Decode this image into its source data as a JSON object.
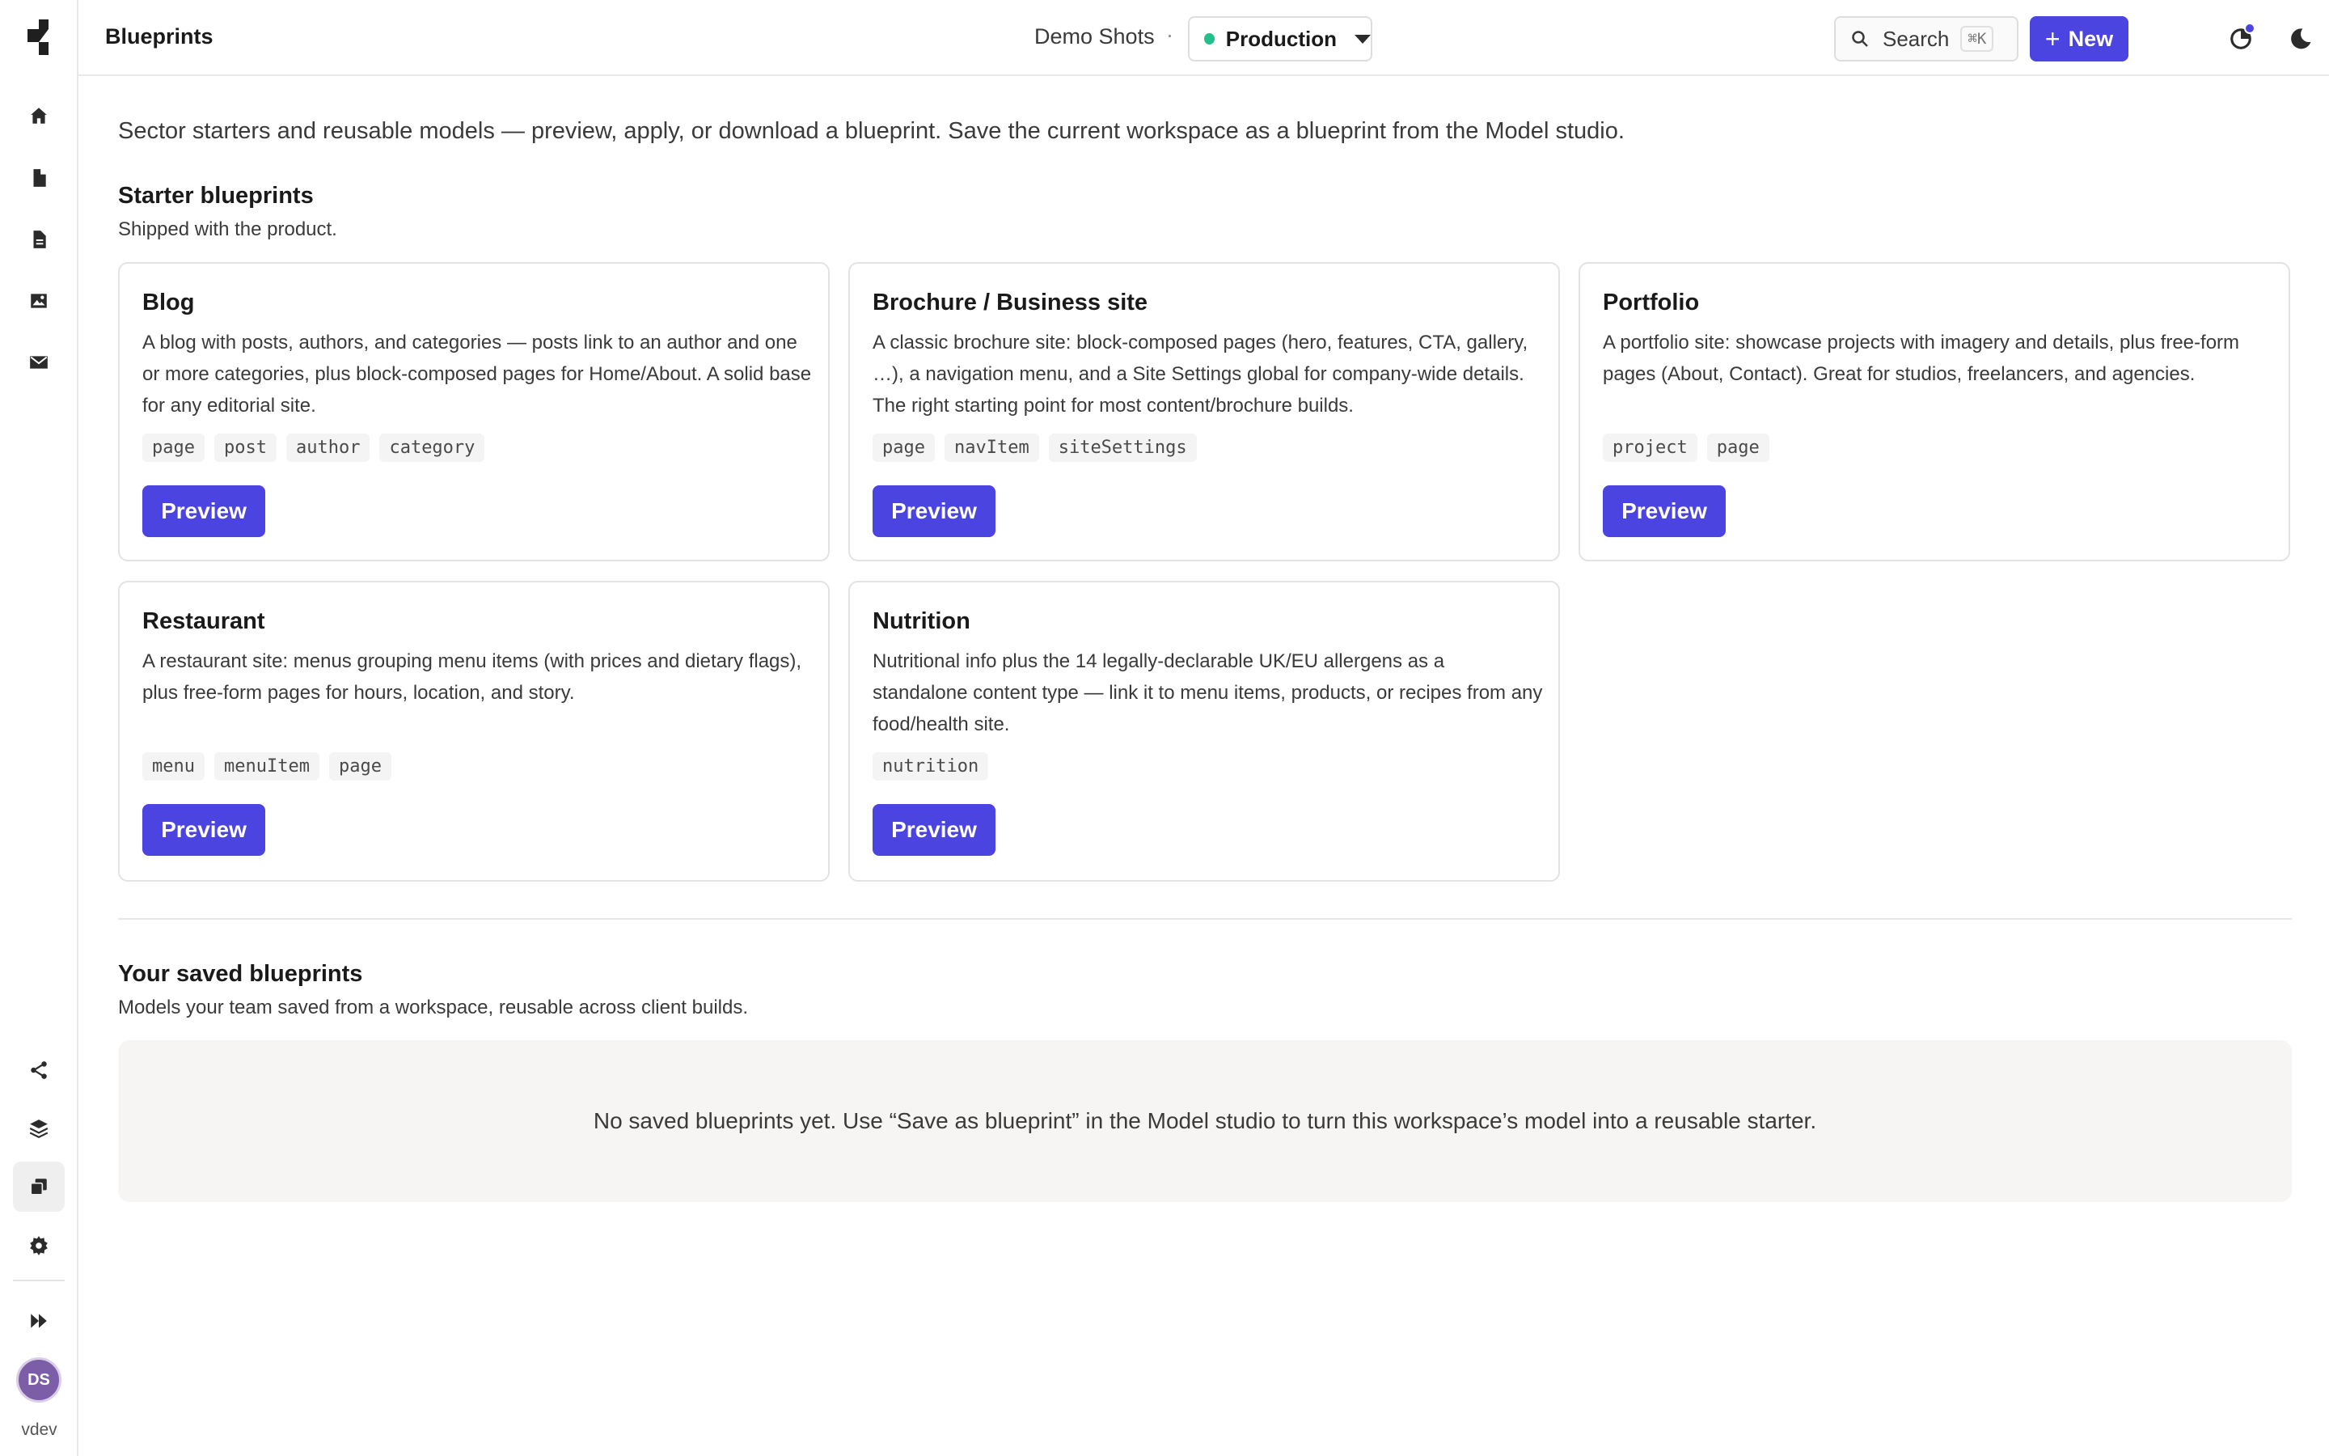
{
  "header": {
    "title": "Blueprints",
    "workspace": "Demo Shots",
    "separator": "·",
    "environment": "Production",
    "search_label": "Search",
    "search_shortcut": "⌘K",
    "new_label": "New",
    "help_label": "?"
  },
  "sidebar": {
    "avatar_initials": "DS",
    "env_label": "vdev",
    "accent": "#4b44e0"
  },
  "main": {
    "intro": "Sector starters and reusable models — preview, apply, or download a blueprint. Save the current workspace as a blueprint from the Model studio.",
    "starter": {
      "title": "Starter blueprints",
      "subtitle": "Shipped with the product.",
      "cards": [
        {
          "title": "Blog",
          "description": "A blog with posts, authors, and categories — posts link to an author and one or more categories, plus block-composed pages for Home/About. A solid base for any editorial site.",
          "tags": [
            "page",
            "post",
            "author",
            "category"
          ],
          "button": "Preview"
        },
        {
          "title": "Brochure / Business site",
          "description": "A classic brochure site: block-composed pages (hero, features, CTA, gallery, …), a navigation menu, and a Site Settings global for company-wide details. The right starting point for most content/brochure builds.",
          "tags": [
            "page",
            "navItem",
            "siteSettings"
          ],
          "button": "Preview"
        },
        {
          "title": "Portfolio",
          "description": "A portfolio site: showcase projects with imagery and details, plus free-form pages (About, Contact). Great for studios, freelancers, and agencies.",
          "tags": [
            "project",
            "page"
          ],
          "button": "Preview"
        },
        {
          "title": "Restaurant",
          "description": "A restaurant site: menus grouping menu items (with prices and dietary flags), plus free-form pages for hours, location, and story.",
          "tags": [
            "menu",
            "menuItem",
            "page"
          ],
          "button": "Preview"
        },
        {
          "title": "Nutrition",
          "description": "Nutritional info plus the 14 legally-declarable UK/EU allergens as a standalone content type — link it to menu items, products, or recipes from any food/health site.",
          "tags": [
            "nutrition"
          ],
          "button": "Preview"
        }
      ]
    },
    "saved": {
      "title": "Your saved blueprints",
      "subtitle": "Models your team saved from a workspace, reusable across client builds.",
      "empty_message": "No saved blueprints yet. Use “Save as blueprint” in the Model studio to turn this workspace’s model into a reusable starter."
    }
  }
}
